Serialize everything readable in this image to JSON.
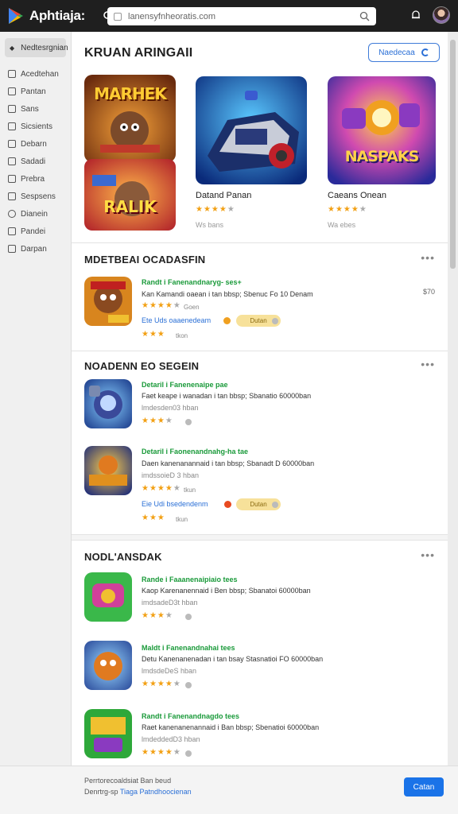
{
  "app": {
    "name": "Aphtiaja:"
  },
  "urlbar": {
    "url": "lanensyfnheoratis.com"
  },
  "sidebar": {
    "header": "Nedtesrgnian",
    "items": [
      {
        "label": "Acedtehan",
        "icon": "grid-icon"
      },
      {
        "label": "Pantan",
        "icon": "bag-icon"
      },
      {
        "label": "Sans",
        "icon": "card-icon"
      },
      {
        "label": "Sicsients",
        "icon": "list-icon"
      },
      {
        "label": "Debarn",
        "icon": "tag-icon"
      },
      {
        "label": "Sadadi",
        "icon": "doc-icon"
      },
      {
        "label": "Prebra",
        "icon": "book-icon"
      },
      {
        "label": "Sespsens",
        "icon": "pin-icon"
      },
      {
        "label": "Dianein",
        "icon": "circle-icon"
      },
      {
        "label": "Pandei",
        "icon": "chart-icon"
      },
      {
        "label": "Darpan",
        "icon": "folder-icon"
      }
    ]
  },
  "featured": {
    "title": "KRUAN ARINGAII",
    "button": "Naedecaa",
    "cards": [
      {
        "name": "",
        "tile_text": "MARHEK",
        "sub": ""
      },
      {
        "name": "",
        "tile_text": "RALIK",
        "sub": ""
      },
      {
        "name": "Datand Panan",
        "stars": "★★★★",
        "sub": "Ws bans"
      },
      {
        "name": "Caeans Onean",
        "stars": "★★★★",
        "sub": "Wa ebes",
        "tile_text": "NASPAKS"
      }
    ]
  },
  "sections": [
    {
      "title": "MDETBEAI OCADASFIN",
      "rows": [
        {
          "title": "Randt i Fanenandnaryg- ses+",
          "desc": "Kan Kamandi oaean i tan bbsp; Sbenuc Fo 10 Denam",
          "stars": "★★★★",
          "meta_small": "Goen",
          "link": "Ete Uds oaaenedeam",
          "pill": "Dutan",
          "stars2": "★★★",
          "stars2_small": "tkon",
          "price": "$70"
        }
      ]
    },
    {
      "title": "NOADENN EO SEGEIN",
      "rows": [
        {
          "title": "Detaril i Fanenenaipe pae",
          "desc": "Faet keape i wanadan i tan bbsp; Sbanatio 60000ban",
          "meta": "lmdesden03 hban",
          "stars": "★★★"
        },
        {
          "title": "Detaril i Faonenandnahg-ha tae",
          "desc": "Daen kanenanannaid i tan bbsp; Sbanadt D 60000ban",
          "meta": "imdssoieD 3 hban",
          "stars": "★★★★",
          "meta_small": "tkun",
          "link": "Eie Udi bsedendenm",
          "pill": "Dutan",
          "stars2": "★★★",
          "stars2_small": "tkun"
        }
      ]
    },
    {
      "title": "NODL'ANSDAK",
      "rows": [
        {
          "title": "Rande i Faaanenaipiaio tees",
          "desc": "Kaop Karenanennaid i Ben bbsp; Sbanatoi 60000ban",
          "meta": "imdsadeD3t hban",
          "stars": "★★★"
        },
        {
          "title": "Maldt i Fanenandnahai tees",
          "desc": "Detu Kanenanenadan i tan bsay Stasnatioi FO 60000ban",
          "meta": "lmdsdeDeS hban",
          "stars": "★★★★"
        },
        {
          "title": "Randt i Fanenandnagdo tees",
          "desc": "Raet kanenanenannaid i Ban bbsp; Sbenatioi 60000ban",
          "meta": "lmdeddedD3 hban",
          "stars": "★★★★"
        }
      ]
    }
  ],
  "bottom": {
    "line1": "Perrtorecoaldsiat Ban beud",
    "line2_prefix": "Denrtrg-sp",
    "line2_link": "Tiaga Patndhoocienan",
    "button": "Catan"
  },
  "colors": {
    "accent": "#1a73e8",
    "star": "#f2a014",
    "title_green": "#1a9a3a"
  }
}
